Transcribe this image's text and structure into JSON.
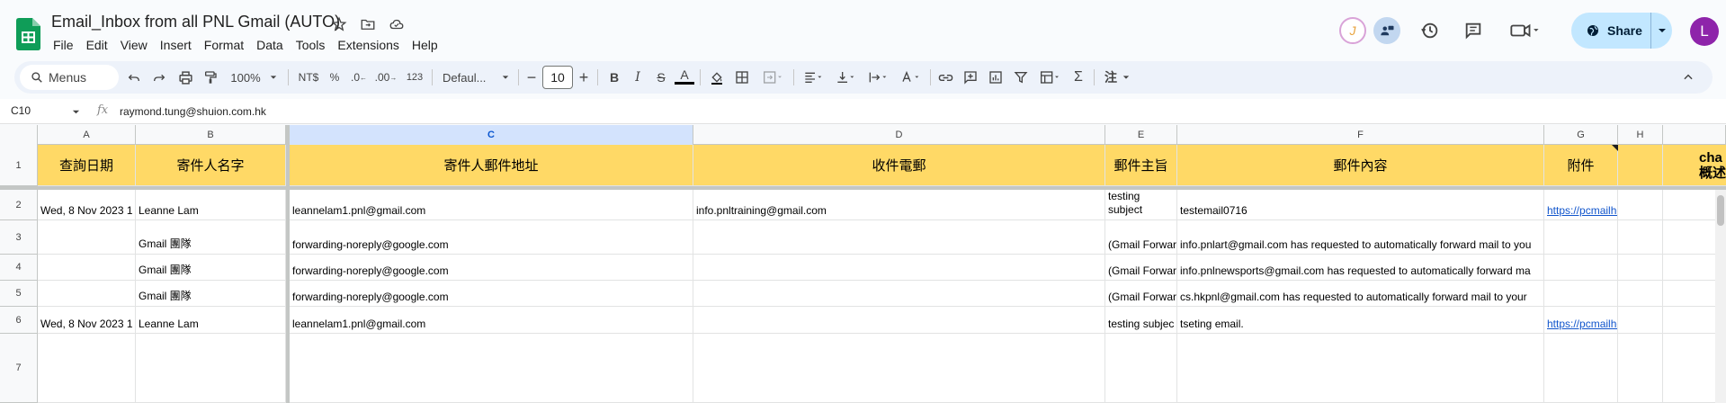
{
  "doc": {
    "title": "Email_Inbox from all PNL Gmail (AUTO)",
    "menu": [
      "File",
      "Edit",
      "View",
      "Insert",
      "Format",
      "Data",
      "Tools",
      "Extensions",
      "Help"
    ]
  },
  "header_right": {
    "share_label": "Share",
    "user_initial": "L",
    "avatar_j": "J"
  },
  "toolbar": {
    "search_label": "Menus",
    "zoom": "100%",
    "currency": "NT$",
    "percent": "%",
    "dec_decrease": ".0",
    "dec_increase": ".00",
    "number_format": "123",
    "font": "Defaul...",
    "font_size": "10",
    "bold": "B",
    "italic": "I",
    "strike": "S",
    "text_color": "A",
    "sigma": "Σ",
    "ime": "注"
  },
  "formula": {
    "cell_ref": "C10",
    "fx": "fx",
    "value": "raymond.tung@shuion.com.hk"
  },
  "columns": [
    "A",
    "B",
    "C",
    "D",
    "E",
    "F",
    "G",
    "H"
  ],
  "rows": [
    "1",
    "2",
    "3",
    "4",
    "5",
    "6",
    "7"
  ],
  "header_row": {
    "A": "查詢日期",
    "B": "寄件人名字",
    "C": "寄件人郵件地址",
    "D": "收件電郵",
    "E": "郵件主旨",
    "F": "郵件內容",
    "G": "附件",
    "H": "",
    "I_top": "cha",
    "I_bottom": "概述"
  },
  "data_rows": [
    {
      "A": "Wed, 8 Nov 2023 1",
      "B": "Leanne Lam",
      "C": "leannelam1.pnl@gmail.com",
      "D": "info.pnltraining@gmail.com",
      "E": "testing subject",
      "F": "testemail0716",
      "G": "https://pcmailhook.com/attachmen"
    },
    {
      "A": "",
      "B": "Gmail 團隊",
      "C": "forwarding-noreply@google.com",
      "D": "",
      "E": "(Gmail Forwar",
      "F": "info.pnlart@gmail.com has requested to automatically forward mail to you",
      "G": ""
    },
    {
      "A": "",
      "B": "Gmail 團隊",
      "C": "forwarding-noreply@google.com",
      "D": "",
      "E": "(Gmail Forwar",
      "F": "info.pnlnewsports@gmail.com has requested to automatically forward ma",
      "G": ""
    },
    {
      "A": "",
      "B": "Gmail 團隊",
      "C": "forwarding-noreply@google.com",
      "D": "",
      "E": "(Gmail Forwar",
      "F": "cs.hkpnl@gmail.com has requested to automatically forward mail to your",
      "G": ""
    },
    {
      "A": "Wed, 8 Nov 2023 1",
      "B": "Leanne Lam",
      "C": "leannelam1.pnl@gmail.com",
      "D": "",
      "E": "testing subjec",
      "F": "tseting email.",
      "G": "https://pcmailhook.com/attachmen"
    },
    {
      "A": "",
      "B": "",
      "C": "",
      "D": "",
      "E": "",
      "F": "",
      "G": ""
    }
  ],
  "colors": {
    "header_fill": "#ffd966",
    "selected_col": "#d3e3fd",
    "share_bg": "#c2e7ff",
    "user_avatar": "#8e24aa",
    "link": "#1155cc"
  }
}
